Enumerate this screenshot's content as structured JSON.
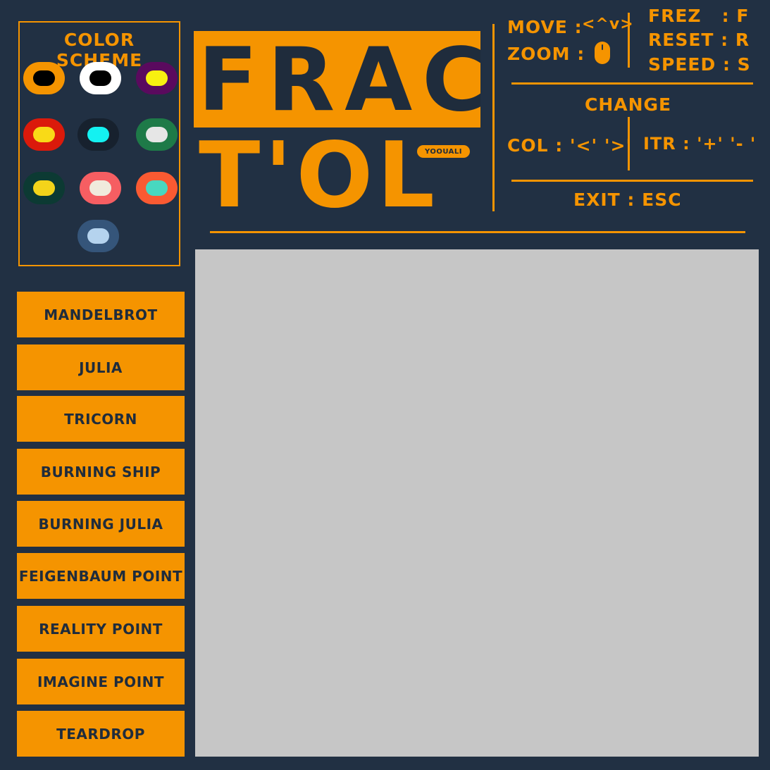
{
  "colors": {
    "background": "#213043",
    "accent": "#f59400",
    "canvas": "#c6c6c6"
  },
  "color_scheme": {
    "title": "Color Scheme",
    "swatches": [
      {
        "outer": "#f59400",
        "inner": "#000000"
      },
      {
        "outer": "#ffffff",
        "inner": "#000000"
      },
      {
        "outer": "#5a0a5e",
        "inner": "#f7f010"
      },
      {
        "outer": "#db1a0b",
        "inner": "#f9da17"
      },
      {
        "outer": "#17212e",
        "inner": "#14f1f1"
      },
      {
        "outer": "#1e7a48",
        "inner": "#e6e6e6"
      },
      {
        "outer": "#0c3a33",
        "inner": "#f3d41a"
      },
      {
        "outer": "#f65e62",
        "inner": "#f0eadc"
      },
      {
        "outer": "#fa5a32",
        "inner": "#48d8c0"
      },
      {
        "outer": "#35557a",
        "inner": "#b5d3ee"
      }
    ]
  },
  "fractals": [
    "Mandelbrot",
    "Julia",
    "Tricorn",
    "Burning Ship",
    "Burning Julia",
    "Feigenbaum Point",
    "Reality Point",
    "Imagine Point",
    "Teardrop"
  ],
  "logo": {
    "line1": "FRAC",
    "line2": "T'OL",
    "badge": "YOOUALI"
  },
  "controls": {
    "move_label": "MOVE :",
    "move_keys": "<^v>",
    "zoom_label": "ZOOM :",
    "frez": "FREZ   : F",
    "reset": "RESET : R",
    "speed": "SPEED : S",
    "change_title": "CHANGE",
    "col": "COL : '<' '>'",
    "itr": "ITR : '+' '- '",
    "exit": "EXIT : ESC"
  }
}
